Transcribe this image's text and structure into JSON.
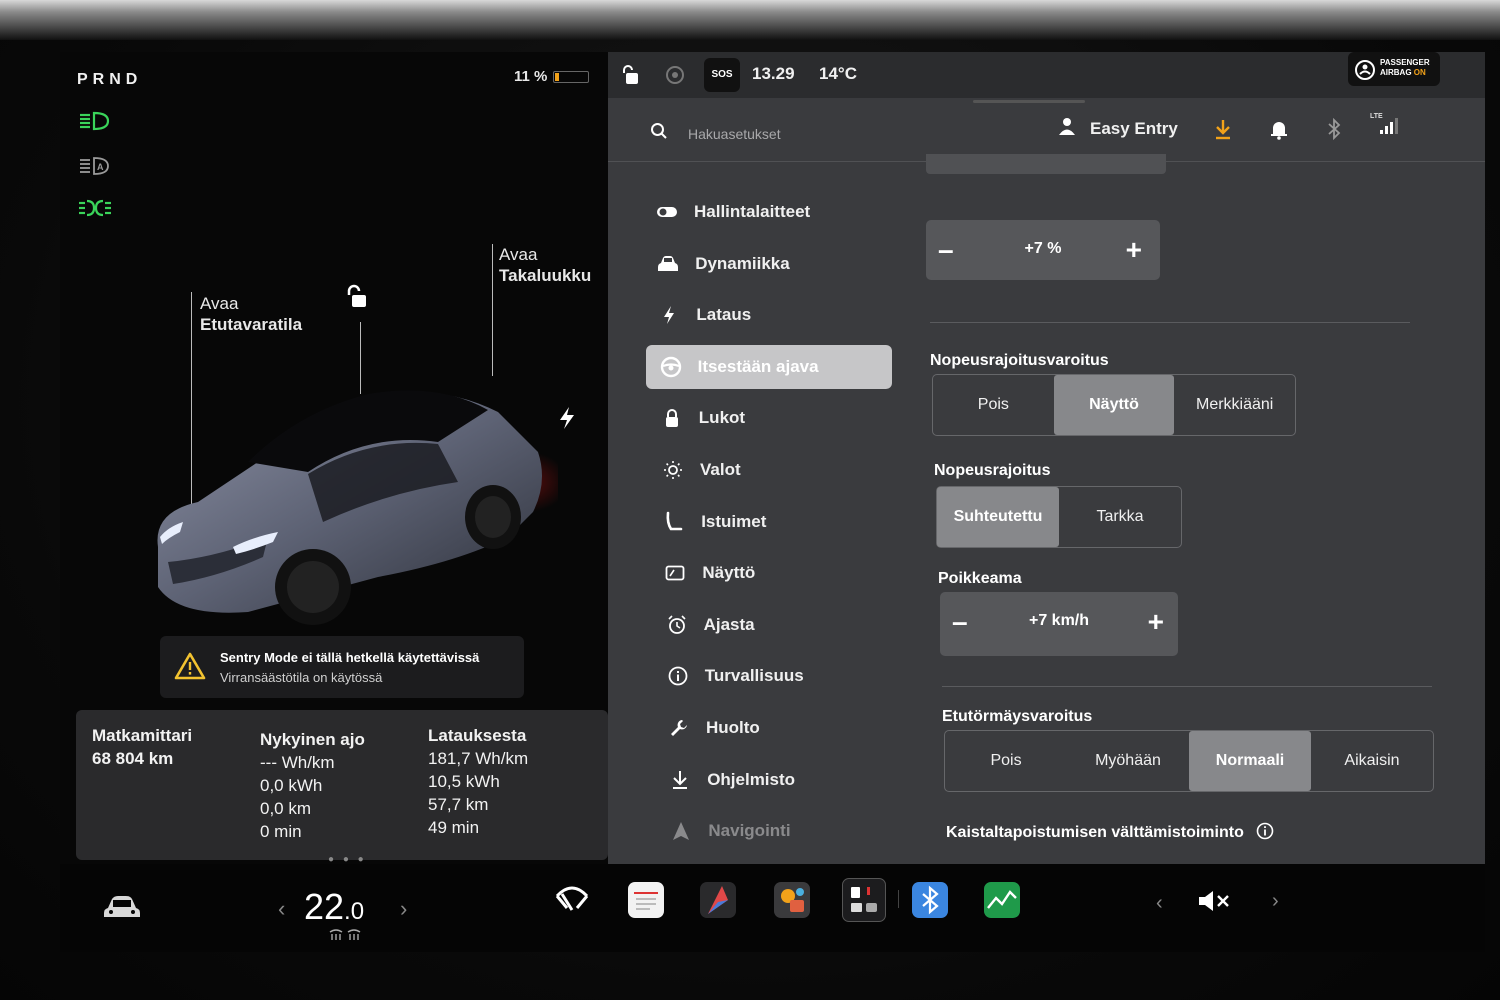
{
  "gear": "PRND",
  "battery": {
    "percent_text": "11 %",
    "level": 0.11
  },
  "callouts": {
    "frunk_open": "Avaa",
    "frunk_label": "Etutavaratila",
    "trunk_open": "Avaa",
    "trunk_label": "Takaluukku"
  },
  "sentry": {
    "title": "Sentry Mode ei tällä hetkellä käytettävissä",
    "subtitle": "Virransäästötila on käytössä"
  },
  "trip": {
    "odometer": {
      "title": "Matkamittari",
      "lines": [
        "68 804 km"
      ]
    },
    "current": {
      "title": "Nykyinen ajo",
      "lines": [
        "--- Wh/km",
        "0,0 kWh",
        "0,0 km",
        "0 min"
      ]
    },
    "since_charge": {
      "title": "Latauksesta",
      "lines": [
        "181,7 Wh/km",
        "10,5 kWh",
        "57,7 km",
        "49 min"
      ]
    }
  },
  "status": {
    "sos": "SOS",
    "time": "13.29",
    "outside_temp": "14°C",
    "airbag_line1": "PASSENGER",
    "airbag_line2": "AIRBAG",
    "airbag_state": "ON",
    "network": "LTE"
  },
  "search": {
    "placeholder": "Hakuasetukset"
  },
  "profile": {
    "name": "Easy Entry"
  },
  "menu": [
    {
      "label": "Hallintalaitteet",
      "icon": "toggle-icon"
    },
    {
      "label": "Dynamiikka",
      "icon": "car-front-icon"
    },
    {
      "label": "Lataus",
      "icon": "bolt-icon"
    },
    {
      "label": "Itsestään ajava",
      "icon": "steering-wheel-icon",
      "active": true
    },
    {
      "label": "Lukot",
      "icon": "lock-icon"
    },
    {
      "label": "Valot",
      "icon": "sun-icon"
    },
    {
      "label": "Istuimet",
      "icon": "seat-icon"
    },
    {
      "label": "Näyttö",
      "icon": "display-icon"
    },
    {
      "label": "Ajasta",
      "icon": "alarm-clock-icon"
    },
    {
      "label": "Turvallisuus",
      "icon": "info-circle-icon"
    },
    {
      "label": "Huolto",
      "icon": "wrench-icon"
    },
    {
      "label": "Ohjelmisto",
      "icon": "download-icon"
    },
    {
      "label": "Navigointi",
      "icon": "navigation-icon"
    }
  ],
  "settings": {
    "offset_percent": {
      "value": "+7 %"
    },
    "speed_limit_warning": {
      "title": "Nopeusrajoitusvaroitus",
      "options": [
        "Pois",
        "Näyttö",
        "Merkkiääni"
      ],
      "selected": 1
    },
    "speed_limit": {
      "title": "Nopeusrajoitus",
      "options": [
        "Suhteutettu",
        "Tarkka"
      ],
      "selected": 0
    },
    "offset": {
      "title": "Poikkeama",
      "value": "+7 km/h"
    },
    "forward_collision": {
      "title": "Etutörmäysvaroitus",
      "options": [
        "Pois",
        "Myöhään",
        "Normaali",
        "Aikaisin"
      ],
      "selected": 2
    },
    "lane_departure": {
      "title": "Kaistaltapoistumisen välttämistoiminto"
    }
  },
  "climate": {
    "temp_whole": "22",
    "temp_decimal": ".0"
  }
}
